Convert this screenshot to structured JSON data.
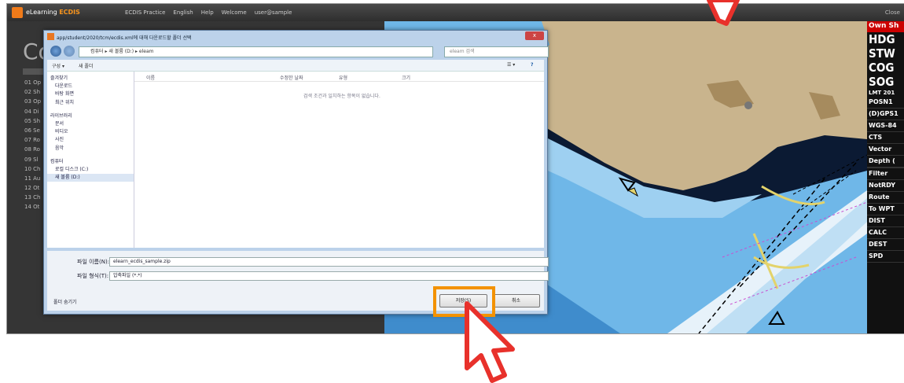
{
  "app": {
    "name_prefix": "eLearning",
    "name_brand": "ECDIS",
    "menu": [
      "ECDIS Practice",
      "English",
      "Help",
      "Welcome",
      "user@sample"
    ],
    "corner": "Close"
  },
  "left_panel": {
    "title": "Co",
    "items": [
      "01 Op",
      "02 Sh",
      "03 Op",
      "04 Di",
      "05 Sh",
      "06 Se",
      "07 Ro",
      "08 Ro",
      "09 Sl",
      "10 Ch",
      "11 Au",
      "12 Ot",
      "13 Ch",
      "14 Ot"
    ]
  },
  "dialog": {
    "title": "app/student/2020/tcm/ecdis.xml에 대해 다운로드할 폴더 선택",
    "close": "x",
    "address": "컴퓨터 ▸ 새 볼륨 (D:) ▸ eleam",
    "search_placeholder": "eleam 검색",
    "toolbar": {
      "organize": "구성 ▾",
      "new_folder": "새 폴더"
    },
    "nav_items": [
      {
        "label": "즐겨찾기",
        "group": true
      },
      {
        "label": "다운로드",
        "group": false
      },
      {
        "label": "바탕 화면",
        "group": false
      },
      {
        "label": "최근 위치",
        "group": false
      },
      {
        "label": "라이브러리",
        "group": true
      },
      {
        "label": "문서",
        "group": false
      },
      {
        "label": "비디오",
        "group": false
      },
      {
        "label": "사진",
        "group": false
      },
      {
        "label": "음악",
        "group": false
      },
      {
        "label": "컴퓨터",
        "group": true
      },
      {
        "label": "로컬 디스크 (C:)",
        "group": false
      },
      {
        "label": "새 볼륨 (D:)",
        "group": false
      }
    ],
    "columns": [
      "이름",
      "수정한 날짜",
      "유형",
      "크기"
    ],
    "empty_text": "검색 조건과 일치하는 항목이 없습니다.",
    "filename_label": "파일 이름(N):",
    "filename_value": "elearn_ecdis_sample.zip",
    "filetype_label": "파일 형식(T):",
    "filetype_value": "압축파일 (*.*)",
    "hide_folders": "폴더 숨기기",
    "save_button": "저장(S)",
    "cancel_button": "취소"
  },
  "right_panel": {
    "own_ship": "Own Sh",
    "big": [
      "HDG",
      "STW",
      "COG",
      "SOG"
    ],
    "lmt": "LMT 201",
    "items": [
      "POSN1",
      "(D)GPS1",
      "WGS-84",
      "CTS",
      "Vector",
      "Depth (",
      "",
      "Filter",
      "NotRDY",
      "Route",
      "To WPT",
      "DIST",
      "CALC",
      "DEST",
      "SPD"
    ]
  },
  "colors": {
    "land": "#c9b48d",
    "dark_land": "#a68b5e",
    "shallow_blue": "#6fb7e8",
    "deep_blue": "#bfdff4",
    "channel": "#e7f2fa",
    "dark_navy": "#0b1a33",
    "highlight": "#f39200",
    "arrow": "#e8312b"
  }
}
